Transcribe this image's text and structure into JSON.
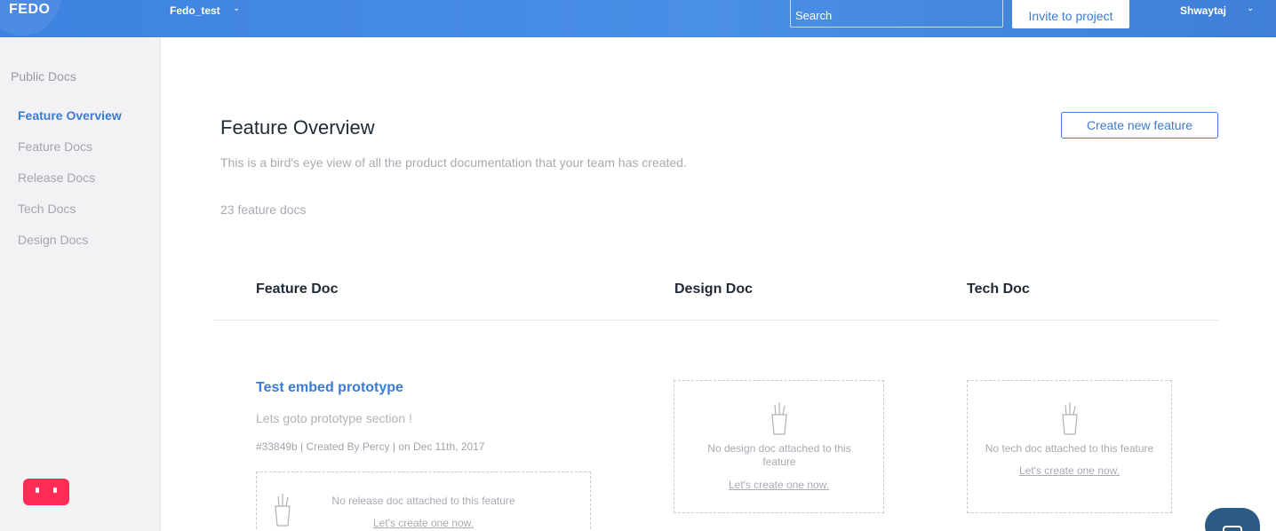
{
  "header": {
    "logo": "FEDO",
    "project_name": "Fedo_test",
    "search_placeholder": "Search",
    "invite_label": "Invite to project",
    "user_name": "Shwaytaj"
  },
  "sidebar": {
    "heading": "Public Docs",
    "items": [
      {
        "label": "Feature Overview",
        "active": true
      },
      {
        "label": "Feature Docs",
        "active": false
      },
      {
        "label": "Release Docs",
        "active": false
      },
      {
        "label": "Tech Docs",
        "active": false
      },
      {
        "label": "Design Docs",
        "active": false
      }
    ]
  },
  "main": {
    "title": "Feature Overview",
    "subtitle": "This is a bird's eye view of all the product documentation that your team has created.",
    "count": "23 feature docs",
    "create_label": "Create new feature",
    "columns": [
      "Feature Doc",
      "Design Doc",
      "Tech Doc"
    ],
    "feature": {
      "title": "Test embed prototype",
      "description": "Lets goto prototype section !",
      "meta": "#33849b | Created By Percy | on Dec 11th, 2017"
    },
    "release_empty": {
      "text": "No release doc attached to this feature",
      "link": "Let's create one now."
    },
    "design_empty": {
      "text": "No design doc attached to this feature",
      "link": "Let's create one now."
    },
    "tech_empty": {
      "text": "No tech doc attached to this feature",
      "link": "Let's create one now."
    }
  },
  "colors": {
    "accent": "#3a7bd5",
    "header_bg": "#4a8fe6",
    "chat_widget": "#ff2d55",
    "support_chat": "#2b5b84"
  }
}
